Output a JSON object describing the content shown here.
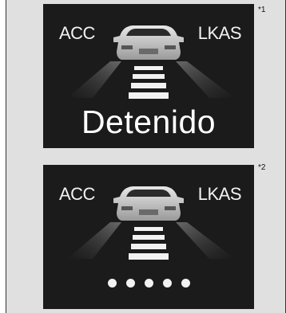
{
  "notes": {
    "first": "*1",
    "second": "*2"
  },
  "panel1": {
    "acc_label": "ACC",
    "lkas_label": "LKAS",
    "status_text": "Detenido"
  },
  "panel2": {
    "acc_label": "ACC",
    "lkas_label": "LKAS",
    "indicator_count": 5
  },
  "colors": {
    "panel_bg": "#1b1b1b",
    "text": "#f2f2f2",
    "page_bg": "#e0e0e0"
  }
}
